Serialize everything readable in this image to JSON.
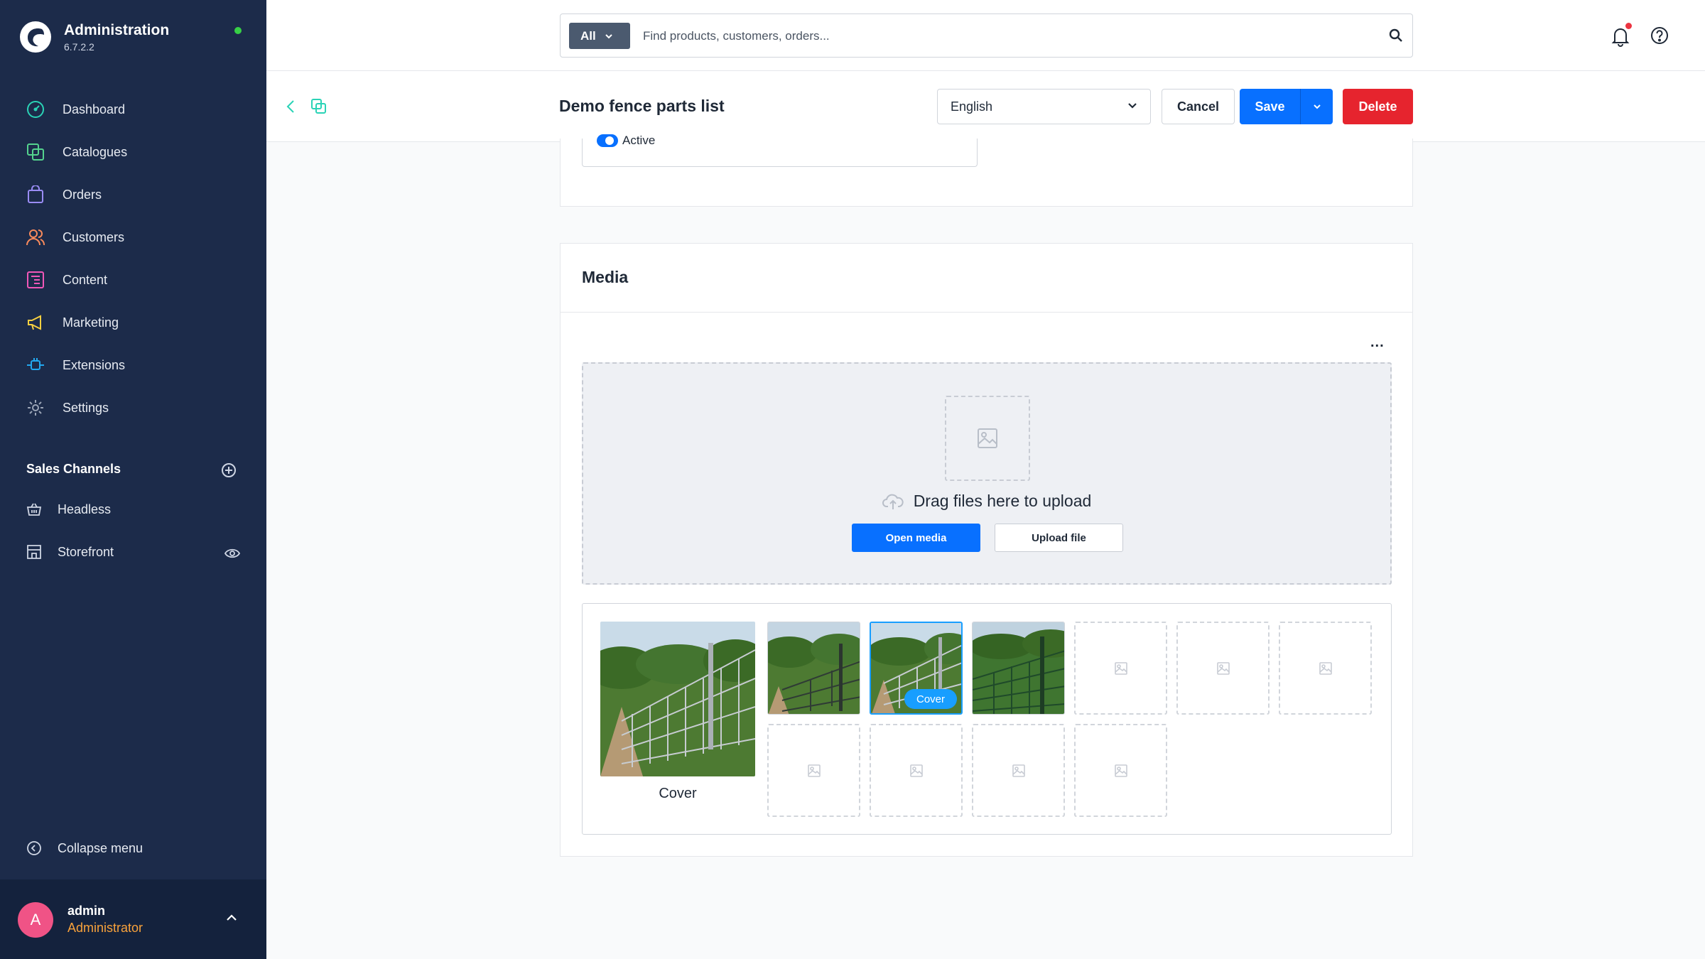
{
  "app": {
    "title": "Administration",
    "version": "6.7.2.2",
    "status_color": "#37d046"
  },
  "sidebar": {
    "items": [
      {
        "label": "Dashboard",
        "icon": "gauge-icon",
        "color": "#2ad3b6"
      },
      {
        "label": "Catalogues",
        "icon": "catalogue-icon",
        "color": "#54d38e"
      },
      {
        "label": "Orders",
        "icon": "shopping-bag-icon",
        "color": "#9a8cf5"
      },
      {
        "label": "Customers",
        "icon": "users-icon",
        "color": "#f88a5c"
      },
      {
        "label": "Content",
        "icon": "content-icon",
        "color": "#f057b8"
      },
      {
        "label": "Marketing",
        "icon": "megaphone-icon",
        "color": "#f8d040"
      },
      {
        "label": "Extensions",
        "icon": "plug-icon",
        "color": "#22a8f0"
      },
      {
        "label": "Settings",
        "icon": "gear-icon",
        "color": "#9aa4b6"
      }
    ],
    "sales_channels_title": "Sales Channels",
    "sales_channels": [
      {
        "label": "Headless",
        "icon": "basket-icon"
      },
      {
        "label": "Storefront",
        "icon": "storefront-icon"
      }
    ],
    "collapse_label": "Collapse menu",
    "user": {
      "initial": "A",
      "name": "admin",
      "role": "Administrator"
    }
  },
  "header": {
    "search_type": "All",
    "search_placeholder": "Find products, customers, orders..."
  },
  "smartbar": {
    "title": "Demo fence parts list",
    "language": "English",
    "cancel_label": "Cancel",
    "save_label": "Save",
    "delete_label": "Delete"
  },
  "general": {
    "active_label": "Active",
    "active": true
  },
  "media": {
    "title": "Media",
    "menu_label": "...",
    "dropzone_text": "Drag files here to upload",
    "open_media_label": "Open media",
    "upload_file_label": "Upload file",
    "cover_label": "Cover",
    "cover_badge": "Cover",
    "images_count": 3,
    "empty_slots": 7
  },
  "colors": {
    "primary": "#0870ff",
    "danger": "#e6242e",
    "sidebar_bg": "#1c2b4a"
  }
}
